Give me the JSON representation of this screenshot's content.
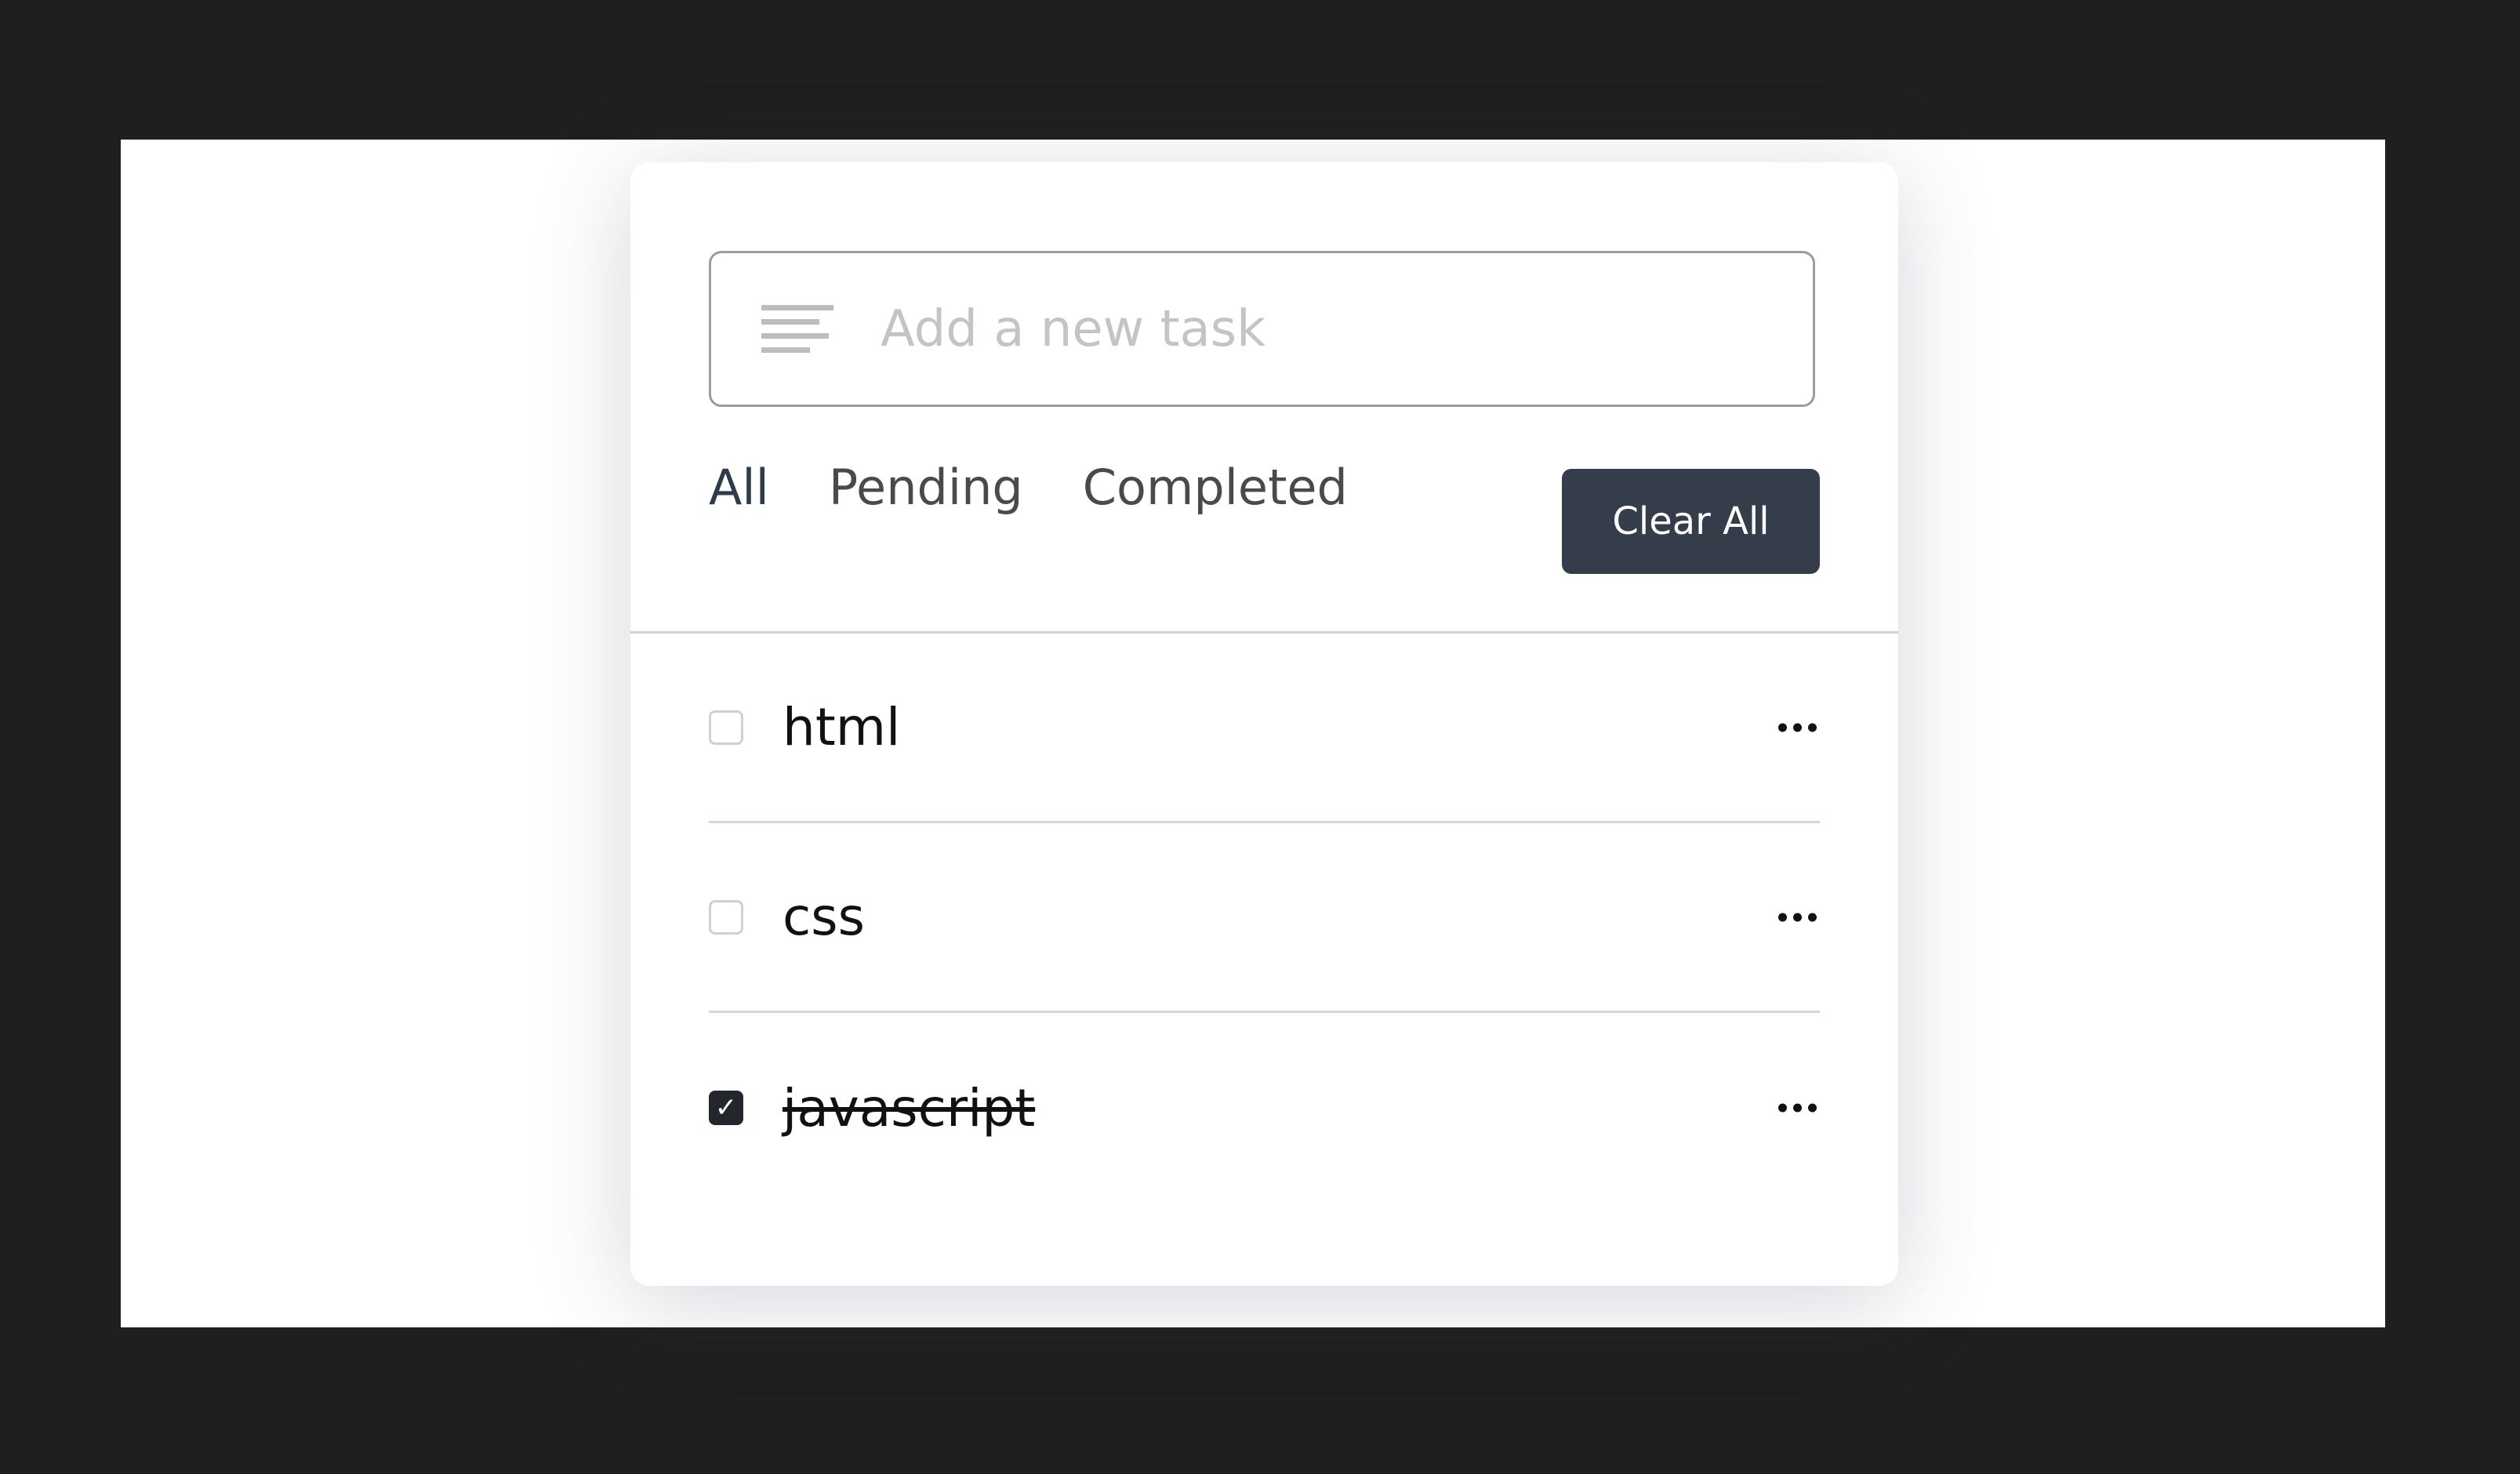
{
  "task_input": {
    "placeholder": "Add a new task",
    "value": "",
    "icon": "text-lines-icon"
  },
  "filters": [
    {
      "label": "All",
      "active": true
    },
    {
      "label": "Pending",
      "active": false
    },
    {
      "label": "Completed",
      "active": false
    }
  ],
  "clear_button": {
    "label": "Clear All"
  },
  "tasks": [
    {
      "label": "html",
      "completed": false
    },
    {
      "label": "css",
      "completed": false
    },
    {
      "label": "javascript",
      "completed": true
    }
  ],
  "colors": {
    "accent": "#353d4b",
    "background": "#1f1f1f"
  }
}
